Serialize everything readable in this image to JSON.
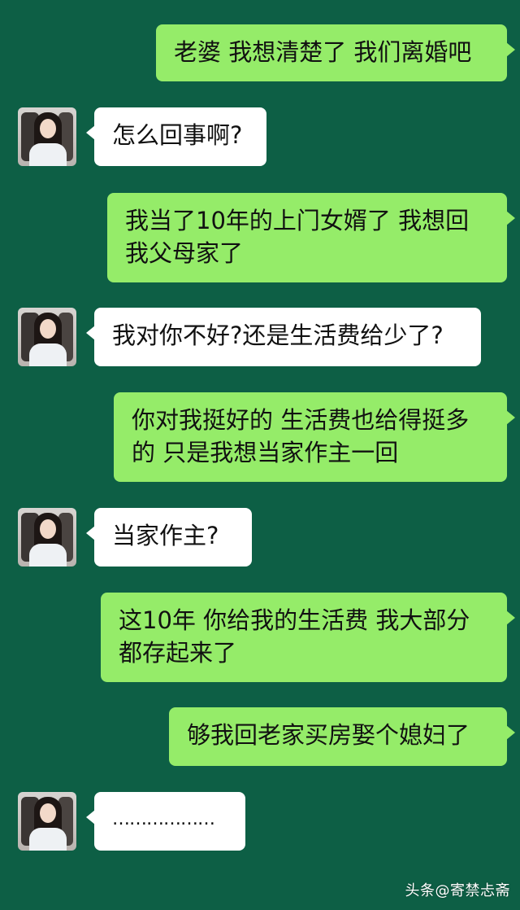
{
  "conversation": {
    "messages": [
      {
        "sender": "me",
        "text": "老婆 我想清楚了 我们离婚吧"
      },
      {
        "sender": "contact",
        "text": "怎么回事啊?"
      },
      {
        "sender": "me",
        "text": "我当了10年的上门女婿了 我想回我父母家了"
      },
      {
        "sender": "contact",
        "text": "我对你不好?还是生活费给少了?"
      },
      {
        "sender": "me",
        "text": "你对我挺好的 生活费也给得挺多的 只是我想当家作主一回"
      },
      {
        "sender": "contact",
        "text": "当家作主?"
      },
      {
        "sender": "me",
        "text": "这10年 你给我的生活费 我大部分都存起来了"
      },
      {
        "sender": "me",
        "text": "够我回老家买房娶个媳妇了"
      },
      {
        "sender": "contact",
        "text": "………………"
      }
    ]
  },
  "watermark": {
    "text": "头条@寄禁忐斋"
  },
  "colors": {
    "background": "#0d5f45",
    "outgoing_bubble": "#95ec69",
    "incoming_bubble": "#ffffff"
  },
  "icons": {
    "contact_avatar": "avatar-photo"
  }
}
